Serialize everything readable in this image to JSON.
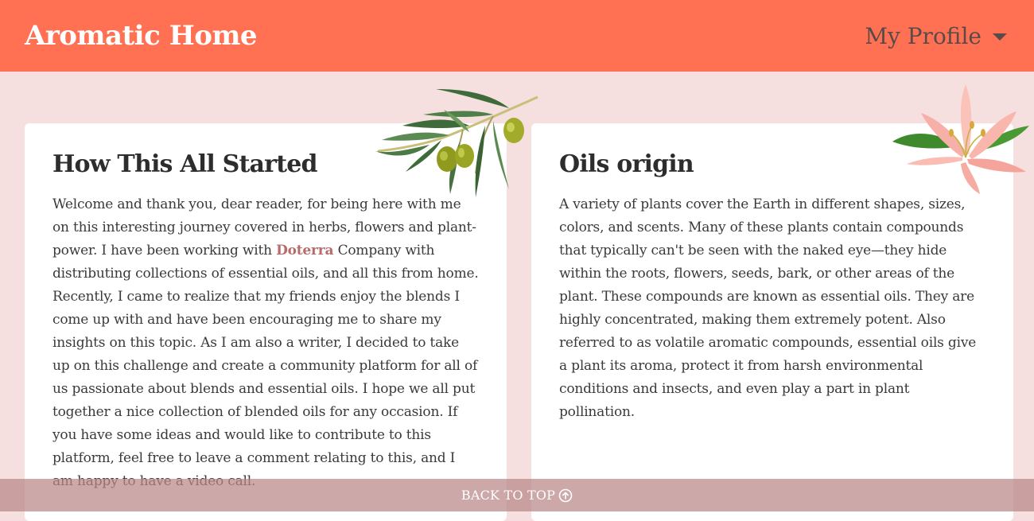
{
  "header": {
    "brand": "Aromatic Home",
    "profile_label": "My Profile"
  },
  "cards": [
    {
      "title": "How This All Started",
      "text_before_link": "Welcome and thank you, dear reader, for being here with me on this interesting journey covered in herbs, flowers and plant-power. I have been working with ",
      "link_text": "Doterra",
      "text_after_link": " Company with distributing collections of essential oils, and all this from home. Recently, I came to realize that my friends enjoy the blends I come up with and have been encouraging me to share my insights on this topic. As I am also a writer, I decided to take up on this challenge and create a community platform for all of us passionate about blends and essential oils. I hope we all put together a nice collection of blended oils for any occasion. If you have some ideas and would like to contribute to this platform, feel free to leave a comment relating to this, and I am happy to have a video call."
    },
    {
      "title": "Oils origin",
      "text": "A variety of plants cover the Earth in different shapes, sizes, colors, and scents. Many of these plants contain compounds that typically can't be seen with the naked eye—they hide within the roots, flowers, seeds, bark, or other areas of the plant. These compounds are known as essential oils. They are highly concentrated, making them extremely potent. Also referred to as volatile aromatic compounds, essential oils give a plant its aroma, protect it from harsh environmental conditions and insects, and even play a part in plant pollination."
    }
  ],
  "footer": {
    "back_to_top": "BACK TO TOP"
  },
  "icons": {
    "caret": "chevron-down-icon",
    "back_to_top": "arrow-up-circle-icon",
    "olive_branch": "olive-branch-icon",
    "lily": "lily-flower-icon"
  },
  "colors": {
    "navbar": "#ff7152",
    "page_background": "#f6dfdf",
    "card_background": "#ffffff",
    "link": "#b86b6b",
    "footer_bar": "#b98787"
  }
}
